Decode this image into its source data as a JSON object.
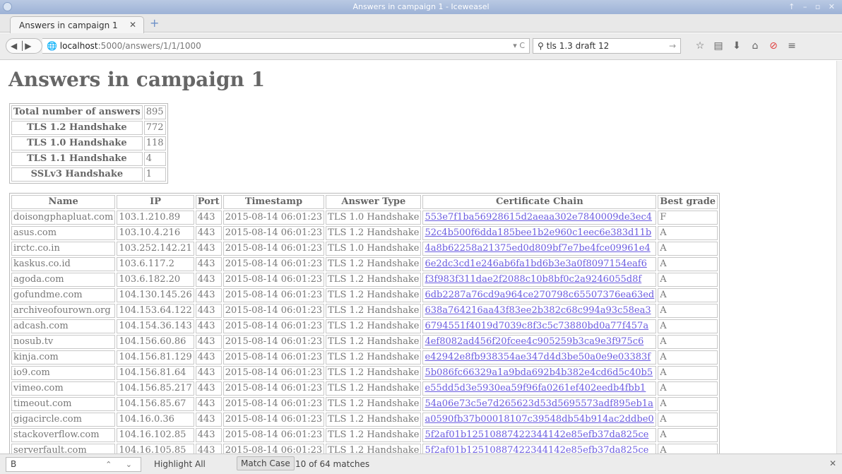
{
  "window": {
    "title": "Answers in campaign 1 - Iceweasel",
    "controls": "↑ – ▫ ✕"
  },
  "tab": {
    "label": "Answers in campaign 1",
    "close": "✕",
    "new_tab": "+"
  },
  "nav": {
    "back_forward": "◀ │▶",
    "url_host": "localhost",
    "url_path": ":5000/answers/1/1/1000",
    "url_extra": "▾ C",
    "search_value": "tls 1.3 draft 12",
    "search_go": "→"
  },
  "page": {
    "heading": "Answers in campaign 1",
    "summary": [
      {
        "label": "Total number of answers",
        "value": "895"
      },
      {
        "label": "TLS 1.2 Handshake",
        "value": "772"
      },
      {
        "label": "TLS 1.0 Handshake",
        "value": "118"
      },
      {
        "label": "TLS 1.1 Handshake",
        "value": "4"
      },
      {
        "label": "SSLv3 Handshake",
        "value": "1"
      }
    ],
    "columns": [
      "Name",
      "IP",
      "Port",
      "Timestamp",
      "Answer Type",
      "Certificate Chain",
      "Best grade"
    ],
    "rows": [
      [
        "doisongphapluat.com",
        "103.1.210.89",
        "443",
        "2015-08-14 06:01:23",
        "TLS 1.0 Handshake",
        "553e7f1ba56928615d2aeaa302e7840009de3ec4",
        "F"
      ],
      [
        "asus.com",
        "103.10.4.216",
        "443",
        "2015-08-14 06:01:23",
        "TLS 1.2 Handshake",
        "52c4b500f6dda185bee1b2e960c1eec6e383d11b",
        "A"
      ],
      [
        "irctc.co.in",
        "103.252.142.21",
        "443",
        "2015-08-14 06:01:23",
        "TLS 1.0 Handshake",
        "4a8b62258a21375ed0d809bf7e7be4fce09961e4",
        "A"
      ],
      [
        "kaskus.co.id",
        "103.6.117.2",
        "443",
        "2015-08-14 06:01:23",
        "TLS 1.2 Handshake",
        "6e2dc3cd1e246ab6fa1bd6b3e3a0f8097154eaf6",
        "A"
      ],
      [
        "agoda.com",
        "103.6.182.20",
        "443",
        "2015-08-14 06:01:23",
        "TLS 1.2 Handshake",
        "f3f983f311dae2f2088c10b8bf0c2a9246055d8f",
        "A"
      ],
      [
        "gofundme.com",
        "104.130.145.26",
        "443",
        "2015-08-14 06:01:23",
        "TLS 1.2 Handshake",
        "6db2287a76cd9a964ce270798c65507376ea63ed",
        "A"
      ],
      [
        "archiveofourown.org",
        "104.153.64.122",
        "443",
        "2015-08-14 06:01:23",
        "TLS 1.2 Handshake",
        "638a764216aa43f83ee2b382c68c994a93c58ea3",
        "A"
      ],
      [
        "adcash.com",
        "104.154.36.143",
        "443",
        "2015-08-14 06:01:23",
        "TLS 1.2 Handshake",
        "6794551f4019d7039c8f3c5c73880bd0a77f457a",
        "A"
      ],
      [
        "nosub.tv",
        "104.156.60.86",
        "443",
        "2015-08-14 06:01:23",
        "TLS 1.2 Handshake",
        "4ef8082ad456f20fcee4c905259b3ca9e3f975c6",
        "A"
      ],
      [
        "kinja.com",
        "104.156.81.129",
        "443",
        "2015-08-14 06:01:23",
        "TLS 1.2 Handshake",
        "e42942e8fb938354ae347d4d3be50a0e9e03383f",
        "A"
      ],
      [
        "io9.com",
        "104.156.81.64",
        "443",
        "2015-08-14 06:01:23",
        "TLS 1.2 Handshake",
        "5b086fc66329a1a9bda692b4b382e4cd6d5c40b5",
        "A"
      ],
      [
        "vimeo.com",
        "104.156.85.217",
        "443",
        "2015-08-14 06:01:23",
        "TLS 1.2 Handshake",
        "e55dd5d3e5930ea59f96fa0261ef402eedb4fbb1",
        "A"
      ],
      [
        "timeout.com",
        "104.156.85.67",
        "443",
        "2015-08-14 06:01:23",
        "TLS 1.2 Handshake",
        "54a06e73c5e7d265623d53d5695573adf895eb1a",
        "A"
      ],
      [
        "gigacircle.com",
        "104.16.0.36",
        "443",
        "2015-08-14 06:01:23",
        "TLS 1.2 Handshake",
        "a0590fb37b00018107c39548db54b914ac2ddbe0",
        "A"
      ],
      [
        "stackoverflow.com",
        "104.16.102.85",
        "443",
        "2015-08-14 06:01:23",
        "TLS 1.2 Handshake",
        "5f2af01b12510887422344142e85efb37da825ce",
        "A"
      ],
      [
        "serverfault.com",
        "104.16.105.85",
        "443",
        "2015-08-14 06:01:23",
        "TLS 1.2 Handshake",
        "5f2af01b12510887422344142e85efb37da825ce",
        "A"
      ]
    ]
  },
  "findbar": {
    "query": "B",
    "updown": "⌃ ⌄",
    "highlight_all": "Highlight All",
    "match_case": "Match Case",
    "matches": "10 of 64 matches",
    "close": "✕"
  },
  "colors": {
    "link": "#6b5ce0",
    "text": "#777777",
    "titlebar": "#a8bcdc"
  }
}
